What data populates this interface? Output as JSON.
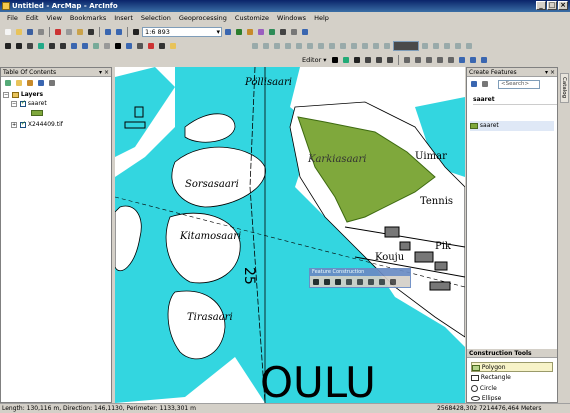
{
  "window": {
    "title": "Untitled - ArcMap - ArcInfo"
  },
  "menu": [
    "File",
    "Edit",
    "View",
    "Bookmarks",
    "Insert",
    "Selection",
    "Geoprocessing",
    "Customize",
    "Windows",
    "Help"
  ],
  "toolbar": {
    "scale": "1:6 893",
    "editor_label": "Editor ▾"
  },
  "toc": {
    "title": "Table Of Contents",
    "layers_label": "Layers",
    "items": [
      {
        "label": "saaret"
      },
      {
        "label": "X244409.tif"
      }
    ]
  },
  "create_features": {
    "title": "Create Features",
    "search_placeholder": "<Search>",
    "group_label": "saaret",
    "template_label": "saaret"
  },
  "construction_tools": {
    "title": "Construction Tools",
    "items": [
      "Polygon",
      "Rectangle",
      "Circle",
      "Ellipse"
    ]
  },
  "catalog_tab": "Catalog",
  "feature_toolbar": {
    "title": "Feature Construction"
  },
  "map_labels": [
    "Pöllisaari",
    "Karkiasaari",
    "Uimar",
    "Tennis",
    "Sorsasaari",
    "Kitamosaari",
    "Kouju",
    "Pik",
    "Tirasaari",
    "OULU",
    "25"
  ],
  "status": {
    "left": "Length: 130,116 m, Direction: 146,1130, Perimeter: 1133,301 m",
    "coords": "2568428,302  7214476,464 Meters"
  },
  "colors": {
    "water": "#33d6e0",
    "polygon": "#7fa83c",
    "land": "#ffffff"
  }
}
